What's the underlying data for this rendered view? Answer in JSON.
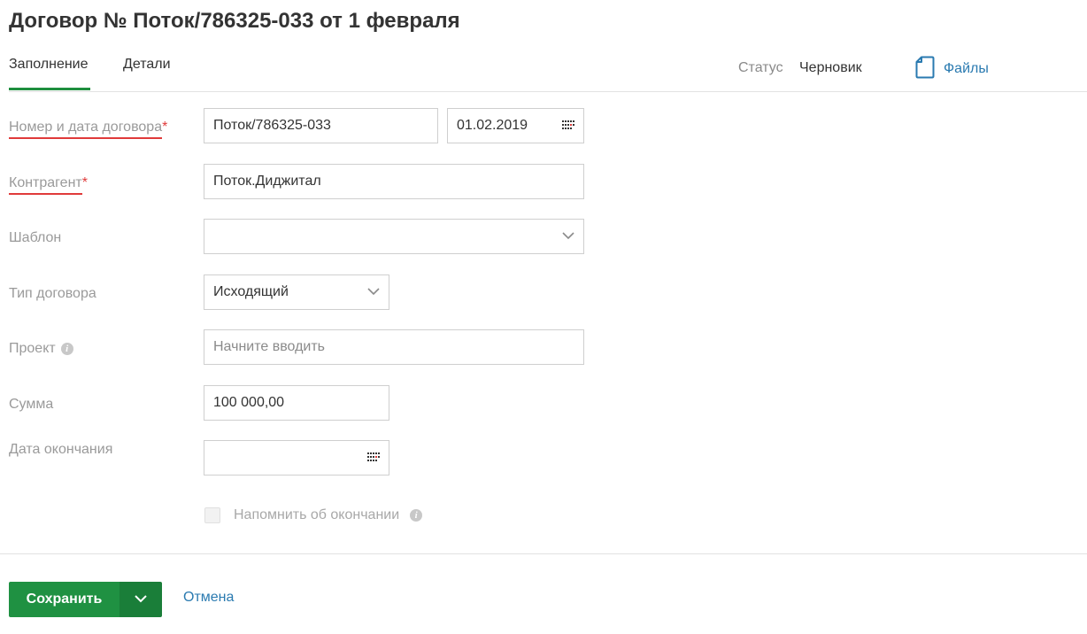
{
  "page": {
    "title": "Договор № Поток/786325-033 от 1 февраля"
  },
  "tabs": [
    {
      "label": "Заполнение",
      "active": true
    },
    {
      "label": "Детали",
      "active": false
    }
  ],
  "status": {
    "label": "Статус",
    "value": "Черновик"
  },
  "files": {
    "label": "Файлы",
    "icon": "file-icon"
  },
  "form": {
    "number_date": {
      "label": "Номер и дата договора",
      "required_mark": "*",
      "number_value": "Поток/786325-033",
      "date_value": "01.02.2019"
    },
    "counterparty": {
      "label": "Контрагент",
      "required_mark": "*",
      "value": "Поток.Диджитал"
    },
    "template": {
      "label": "Шаблон",
      "value": ""
    },
    "contract_type": {
      "label": "Тип договора",
      "value": "Исходящий"
    },
    "project": {
      "label": "Проект",
      "placeholder": "Начните вводить"
    },
    "amount": {
      "label": "Сумма",
      "value": "100 000,00"
    },
    "end_date": {
      "label": "Дата окончания",
      "value": ""
    },
    "remind": {
      "label": "Напомнить об окончании",
      "checked": false,
      "disabled": true
    }
  },
  "actions": {
    "save_label": "Сохранить",
    "cancel_label": "Отмена"
  },
  "colors": {
    "accent_green": "#1f9142",
    "link_blue": "#2a7ab0",
    "required_red": "#e03a3a",
    "calendar_red": "#e03a3a"
  }
}
